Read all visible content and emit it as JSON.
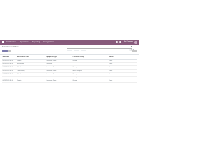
{
  "navbar": {
    "app_name": "Field Service",
    "menu": [
      "Operations",
      "Reporting",
      "Configuration"
    ],
    "company": "My Company"
  },
  "control_panel": {
    "breadcrumb": "Field Service Orders",
    "search_placeholder": "Search...",
    "pager": "1-7 / 7"
  },
  "table": {
    "headers": [
      "Start Date",
      "Maintenance Plan",
      "Equipment Type",
      "Customer Group",
      "Status"
    ],
    "rows": [
      [
        "01/01/2020 08:00",
        "Repair",
        "Customer Group",
        "Group",
        "Done"
      ],
      [
        "01/01/2020 08:00",
        "Installation",
        "Customer",
        "",
        "Done"
      ],
      [
        "01/01/2020 08:00",
        "Check",
        "Customer Group",
        "Group",
        "Done"
      ],
      [
        "01/01/2020 08:00",
        "Consultancy",
        "Customer Group",
        "Main Group A",
        "Done"
      ],
      [
        "01/01/2020 08:00",
        "Check",
        "Customer Group",
        "Group",
        "Done"
      ],
      [
        "01/01/2020 08:00",
        "Check",
        "Customer Group",
        "Group",
        "Done"
      ],
      [
        "01/01/2020 08:00",
        "Repair",
        "Customer Group",
        "Group",
        "Done"
      ]
    ]
  },
  "colors": {
    "navbar": "#875a7b",
    "primary_button": "#7c7bad",
    "status_done": "#28a745"
  }
}
